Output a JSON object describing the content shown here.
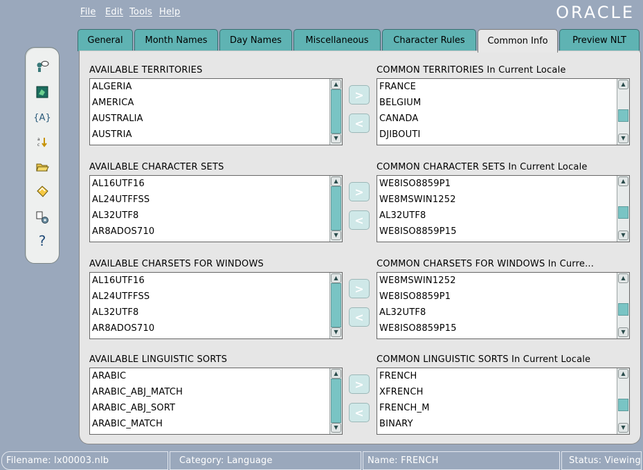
{
  "menu": {
    "file": "File",
    "edit": "Edit",
    "tools": "Tools",
    "help": "Help",
    "brand": "ORACLE"
  },
  "tabs": [
    "General",
    "Month Names",
    "Day Names",
    "Miscellaneous",
    "Character Rules",
    "Common Info",
    "Preview NLT"
  ],
  "active_tab": "Common Info",
  "toolbar_icons": [
    "properties-icon",
    "map-icon",
    "variable-icon",
    "sort-icon",
    "open-folder-icon",
    "save-icon",
    "settings-icon",
    "help-icon"
  ],
  "toolbar": {
    "variable_glyph": "{A}",
    "help_glyph": "?"
  },
  "groups": [
    {
      "available_title": "AVAILABLE TERRITORIES",
      "available_items": [
        "ALGERIA",
        "AMERICA",
        "AUSTRALIA",
        "AUSTRIA"
      ],
      "common_title": "COMMON TERRITORIES In Current Locale",
      "common_items": [
        "FRANCE",
        "BELGIUM",
        "CANADA",
        "DJIBOUTI"
      ]
    },
    {
      "available_title": "AVAILABLE CHARACTER SETS",
      "available_items": [
        "AL16UTF16",
        "AL24UTFFSS",
        "AL32UTF8",
        "AR8ADOS710"
      ],
      "common_title": "COMMON CHARACTER SETS In Current Locale",
      "common_items": [
        "WE8ISO8859P1",
        "WE8MSWIN1252",
        "AL32UTF8",
        "WE8ISO8859P15"
      ]
    },
    {
      "available_title": "AVAILABLE CHARSETS FOR WINDOWS",
      "available_items": [
        "AL16UTF16",
        "AL24UTFFSS",
        "AL32UTF8",
        "AR8ADOS710"
      ],
      "common_title": "COMMON CHARSETS FOR WINDOWS In Curre...",
      "common_items": [
        "WE8MSWIN1252",
        "WE8ISO8859P1",
        "AL32UTF8",
        "WE8ISO8859P15"
      ]
    },
    {
      "available_title": "AVAILABLE LINGUISTIC SORTS",
      "available_items": [
        "ARABIC",
        "ARABIC_ABJ_MATCH",
        "ARABIC_ABJ_SORT",
        "ARABIC_MATCH"
      ],
      "common_title": "COMMON LINGUISTIC SORTS In Current Locale",
      "common_items": [
        "FRENCH",
        "XFRENCH",
        "FRENCH_M",
        "BINARY"
      ]
    }
  ],
  "move_buttons": {
    "add": ">",
    "remove": "<"
  },
  "status": {
    "filename": "Filename: lx00003.nlb",
    "category": "Category: Language",
    "name": "Name: FRENCH",
    "state": "Status: Viewing"
  },
  "colors": {
    "background": "#9aa8bc",
    "tab": "#5fb3b3",
    "active_tab": "#e8e8e8",
    "panel": "#e6e6e6",
    "scroll_thumb": "#79c4c4"
  }
}
